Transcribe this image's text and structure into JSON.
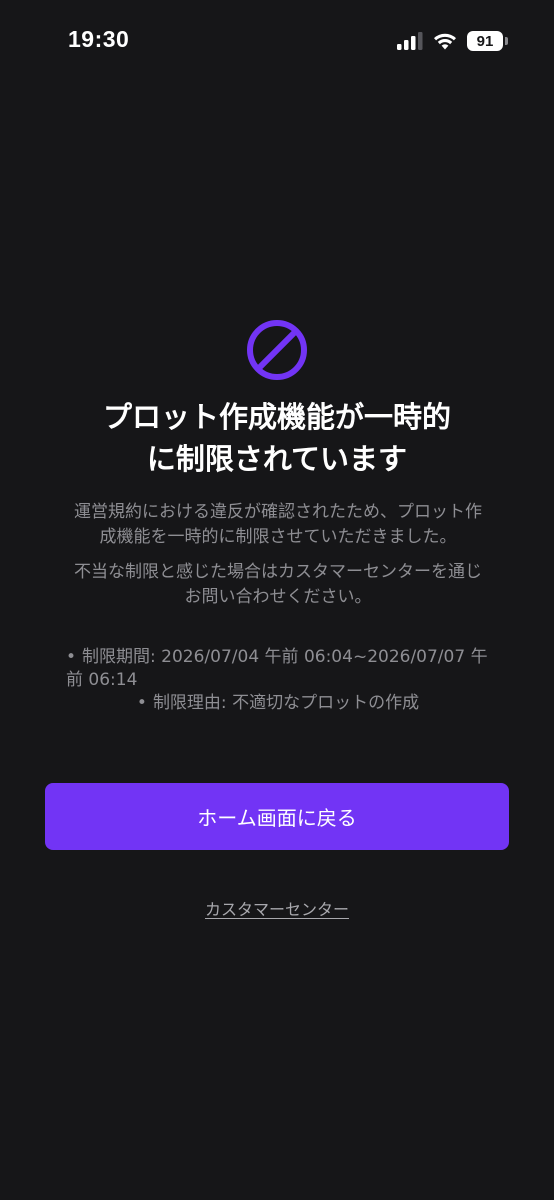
{
  "status_bar": {
    "time": "19:30",
    "battery": "91",
    "icons": [
      "signal-icon",
      "wifi-icon",
      "battery-icon"
    ]
  },
  "icon": "prohibited-icon",
  "accent_color": "#7234f5",
  "title": {
    "line1": "プロット作成機能が一時的",
    "line2": "に制限されています"
  },
  "description": {
    "paragraph1": "運営規約における違反が確認されたため、プロット作成機能を一時的に制限させていただきました。",
    "paragraph2": "不当な制限と感じた場合はカスタマーセンターを通じお問い合わせください。"
  },
  "details": {
    "bullet": "•",
    "period": "制限期間: 2026/07/04 午前 06:04~2026/07/07 午前 06:14",
    "reason": "制限理由: 不適切なプロットの作成"
  },
  "home_button_label": "ホーム画面に戻る",
  "customer_center_link": "カスタマーセンター"
}
